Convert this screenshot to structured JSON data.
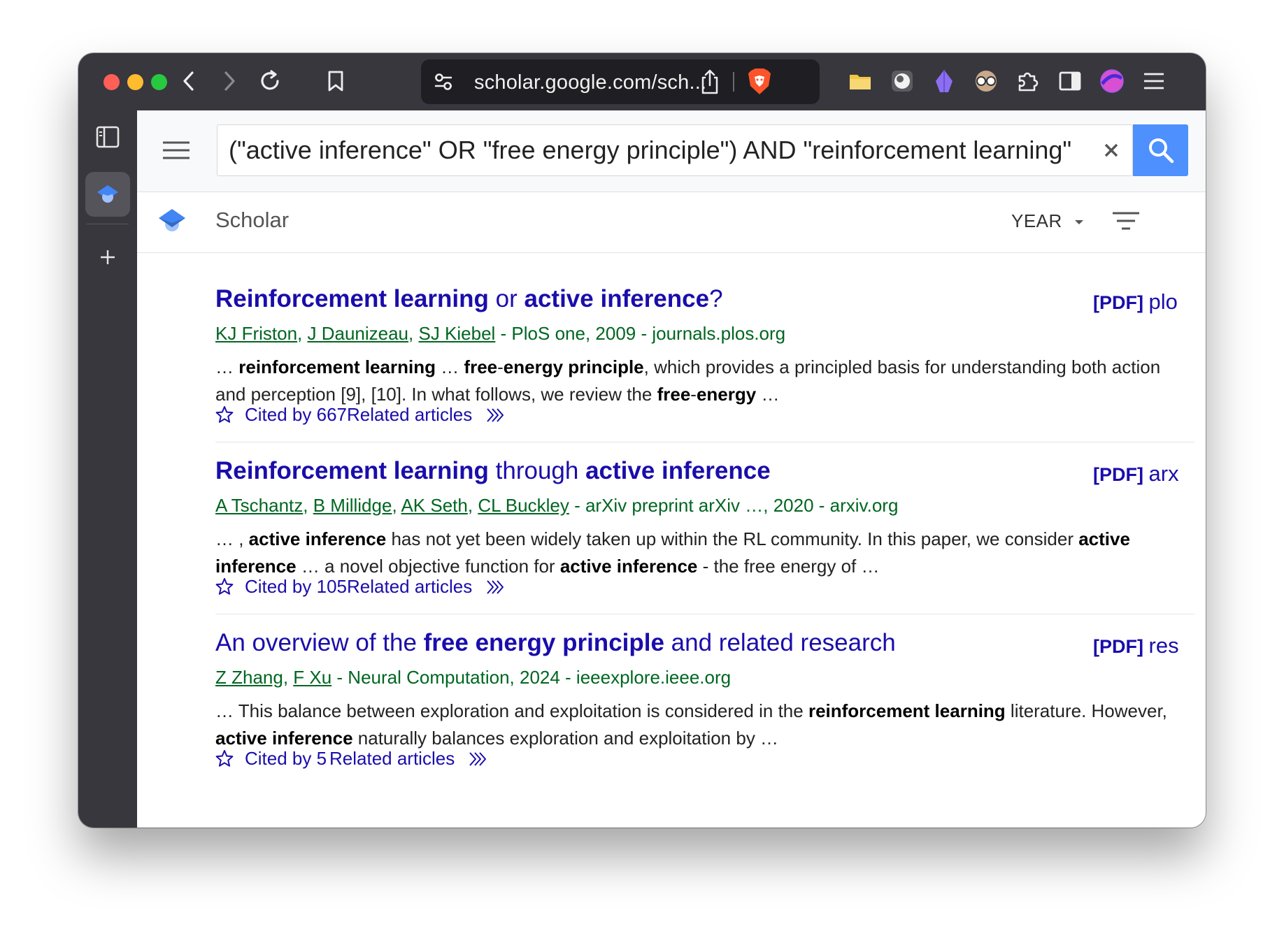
{
  "browser": {
    "url": "scholar.google.com/sch...",
    "colors": {
      "close": "#ff5f57",
      "minimize": "#febc2e",
      "zoom": "#28c840",
      "brave": "#fb542b"
    }
  },
  "search": {
    "query": "(\"active inference\" OR \"free energy principle\") AND \"reinforcement learning\""
  },
  "scholar": {
    "brand": "Scholar",
    "year_label": "YEAR"
  },
  "results": [
    {
      "title_parts": [
        {
          "text": "Reinforcement learning",
          "bold": true
        },
        {
          "text": " or ",
          "bold": false
        },
        {
          "text": "active inference",
          "bold": true
        },
        {
          "text": "?",
          "bold": false
        }
      ],
      "pdf_tag": "[PDF]",
      "pdf_source": "plo",
      "authors": [
        "KJ Friston",
        "J Daunizeau",
        "SJ Kiebel"
      ],
      "venue": " - PloS one, 2009 - journals.plos.org",
      "snippet_parts": [
        {
          "text": "… ",
          "bold": false
        },
        {
          "text": "reinforcement learning",
          "bold": true
        },
        {
          "text": " … ",
          "bold": false
        },
        {
          "text": "free",
          "bold": true
        },
        {
          "text": "-",
          "bold": false
        },
        {
          "text": "energy principle",
          "bold": true
        },
        {
          "text": ", which provides a principled basis for understanding both action and perception [9], [10]. In what follows, we review the ",
          "bold": false
        },
        {
          "text": "free",
          "bold": true
        },
        {
          "text": "-",
          "bold": false
        },
        {
          "text": "energy",
          "bold": true
        },
        {
          "text": " …",
          "bold": false
        }
      ],
      "cited_by": "Cited by 667",
      "related": "Related articles"
    },
    {
      "title_parts": [
        {
          "text": "Reinforcement learning",
          "bold": true
        },
        {
          "text": " through ",
          "bold": false
        },
        {
          "text": "active inference",
          "bold": true
        }
      ],
      "pdf_tag": "[PDF]",
      "pdf_source": "arx",
      "authors": [
        "A Tschantz",
        "B Millidge",
        "AK Seth",
        "CL Buckley"
      ],
      "venue": " - arXiv preprint arXiv …, 2020 - arxiv.org",
      "snippet_parts": [
        {
          "text": "… , ",
          "bold": false
        },
        {
          "text": "active inference",
          "bold": true
        },
        {
          "text": " has not yet been widely taken up within the RL community. In this paper, we consider ",
          "bold": false
        },
        {
          "text": "active inference",
          "bold": true
        },
        {
          "text": " … a novel objective function for ",
          "bold": false
        },
        {
          "text": "active inference",
          "bold": true
        },
        {
          "text": " - the free energy of …",
          "bold": false
        }
      ],
      "cited_by": "Cited by 105",
      "related": "Related articles"
    },
    {
      "title_parts": [
        {
          "text": "An overview of the ",
          "bold": false
        },
        {
          "text": "free energy principle",
          "bold": true
        },
        {
          "text": " and related research",
          "bold": false
        }
      ],
      "pdf_tag": "[PDF]",
      "pdf_source": "res",
      "authors": [
        "Z Zhang",
        "F Xu"
      ],
      "venue": " - Neural Computation, 2024 - ieeexplore.ieee.org",
      "snippet_parts": [
        {
          "text": "… This balance between exploration and exploitation is considered in the ",
          "bold": false
        },
        {
          "text": "reinforcement learning",
          "bold": true
        },
        {
          "text": " literature. However, ",
          "bold": false
        },
        {
          "text": "active inference",
          "bold": true
        },
        {
          "text": " naturally balances exploration and exploitation by …",
          "bold": false
        }
      ],
      "cited_by": "Cited by 5",
      "related": "Related articles"
    }
  ],
  "icons": {
    "back": "chevron-left-icon",
    "forward": "chevron-right-icon",
    "reload": "reload-icon",
    "bookmark": "bookmark-icon",
    "site_settings": "site-settings-icon",
    "share": "share-icon",
    "brave": "brave-shields-icon",
    "ext1": "folder-extension-icon",
    "ext2": "moon-extension-icon",
    "ext3": "purple-extension-icon",
    "ext4": "glasses-extension-icon",
    "extensions": "puzzle-icon",
    "sidebar": "sidebar-toggle-icon",
    "profile": "profile-avatar-icon",
    "menu": "hamburger-menu-icon"
  }
}
